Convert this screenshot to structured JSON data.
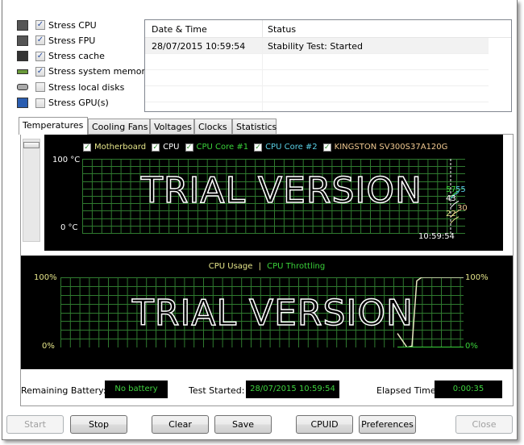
{
  "stress_options": [
    {
      "label": "Stress CPU",
      "checked": true,
      "icon": "cpu-icon"
    },
    {
      "label": "Stress FPU",
      "checked": true,
      "icon": "fpu-icon"
    },
    {
      "label": "Stress cache",
      "checked": true,
      "icon": "cache-icon"
    },
    {
      "label": "Stress system memory",
      "checked": true,
      "icon": "memory-icon"
    },
    {
      "label": "Stress local disks",
      "checked": false,
      "icon": "disk-icon"
    },
    {
      "label": "Stress GPU(s)",
      "checked": false,
      "icon": "gpu-icon"
    }
  ],
  "log": {
    "headers": [
      "Date & Time",
      "Status"
    ],
    "rows": [
      {
        "time": "28/07/2015 10:59:54",
        "status": "Stability Test: Started"
      }
    ]
  },
  "tabs": [
    {
      "label": "Temperatures",
      "selected": true
    },
    {
      "label": "Cooling Fans"
    },
    {
      "label": "Voltages"
    },
    {
      "label": "Clocks"
    },
    {
      "label": "Statistics"
    }
  ],
  "temp_graph": {
    "legend": [
      {
        "label": "Motherboard",
        "color": "#e6e68a"
      },
      {
        "label": "CPU",
        "color": "#ffffff"
      },
      {
        "label": "CPU Core #1",
        "color": "#3ad23a"
      },
      {
        "label": "CPU Core #2",
        "color": "#5ad0e6"
      },
      {
        "label": "KINGSTON SV300S37A120G",
        "color": "#f0c890"
      }
    ],
    "y_max_label": "100 °C",
    "y_min_label": "0 °C",
    "watermark": "TRIAL VERSION",
    "time_label": "10:59:54",
    "readouts": [
      {
        "value": "57",
        "color": "#3ad23a"
      },
      {
        "value": "55",
        "color": "#5ad0e6"
      },
      {
        "value": "43",
        "color": "#ffffff"
      },
      {
        "value": "30",
        "color": "#f0c890"
      },
      {
        "value": "22",
        "color": "#e6e68a"
      }
    ],
    "ylim": [
      0,
      100
    ]
  },
  "cpu_graph": {
    "legend_usage": "CPU Usage",
    "separator": "|",
    "legend_throttling": "CPU Throttling",
    "usage_color": "#e6e68a",
    "throttling_color": "#3ad23a",
    "left_max": "100%",
    "left_min": "0%",
    "right_max": "100%",
    "right_min": "0%",
    "watermark": "TRIAL VERSION",
    "usage_series": [
      20,
      10,
      0,
      2,
      95,
      100,
      100,
      100,
      100,
      100,
      100,
      100,
      100
    ],
    "ylim": [
      0,
      100
    ]
  },
  "status": {
    "battery_label": "Remaining Battery:",
    "battery_value": "No battery",
    "started_label": "Test Started:",
    "started_value": "28/07/2015 10:59:54",
    "elapsed_label": "Elapsed Time:",
    "elapsed_value": "0:00:35"
  },
  "buttons": {
    "start": "Start",
    "stop": "Stop",
    "clear": "Clear",
    "save": "Save",
    "cpuid": "CPUID",
    "preferences": "Preferences",
    "close": "Close"
  }
}
